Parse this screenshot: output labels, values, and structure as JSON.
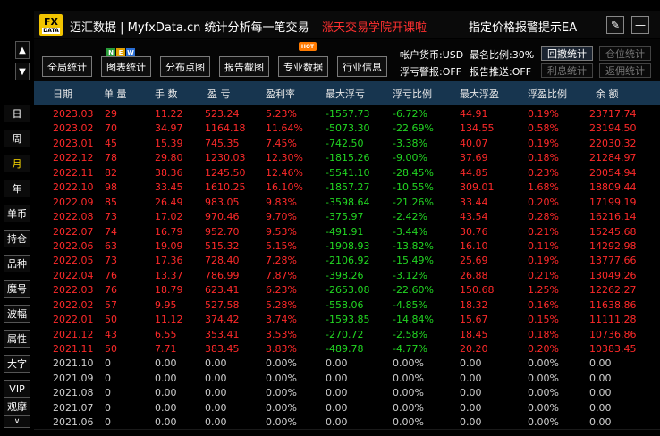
{
  "header": {
    "logo_fx": "FX",
    "logo_data": "DATA",
    "app_title": "迈汇数据 | MyfxData.cn  统计分析每一笔交易",
    "promo": "涨天交易学院开课啦",
    "ea_label": "指定价格报警提示EA",
    "edit_icon": "✎",
    "min_icon": "—"
  },
  "sidebar": {
    "up_arrow": "▲",
    "down_arrow": "▼",
    "period_items": [
      "日",
      "周",
      "月",
      "年"
    ],
    "active_period": "月",
    "tool_items": [
      "单币",
      "持仓",
      "品种",
      "魔号",
      "波幅",
      "属性",
      "大字",
      "VIP",
      "观摩"
    ],
    "more_arrow": "∨"
  },
  "toolbar": {
    "buttons": [
      "全局统计",
      "图表统计",
      "分布点图",
      "报告截图",
      "专业数据",
      "行业信息"
    ],
    "badge_new": [
      "N",
      "E",
      "W"
    ],
    "badge_hot": "HOT",
    "account_currency": "帐户货币:USD",
    "max_ratio": "最名比例:30%",
    "floating_alert": "浮亏警报:OFF",
    "report_push": "报告推送:OFF",
    "small_buttons": [
      "回撤统计",
      "仓位统计",
      "利息统计",
      "返佣统计"
    ]
  },
  "table": {
    "columns": [
      "日期",
      "单 量",
      "手 数",
      "盈 亏",
      "盈利率",
      "最大浮亏",
      "浮亏比例",
      "最大浮盈",
      "浮盈比例",
      "余 额"
    ],
    "rows": [
      [
        "2023.03",
        "29",
        "11.22",
        "523.24",
        "5.23%",
        "-1557.73",
        "-6.72%",
        "44.91",
        "0.19%",
        "23717.74"
      ],
      [
        "2023.02",
        "70",
        "34.97",
        "1164.18",
        "11.64%",
        "-5073.30",
        "-22.69%",
        "134.55",
        "0.58%",
        "23194.50"
      ],
      [
        "2023.01",
        "45",
        "15.39",
        "745.35",
        "7.45%",
        "-742.50",
        "-3.38%",
        "40.07",
        "0.19%",
        "22030.32"
      ],
      [
        "2022.12",
        "78",
        "29.80",
        "1230.03",
        "12.30%",
        "-1815.26",
        "-9.00%",
        "37.69",
        "0.18%",
        "21284.97"
      ],
      [
        "2022.11",
        "82",
        "38.36",
        "1245.50",
        "12.46%",
        "-5541.10",
        "-28.45%",
        "44.85",
        "0.23%",
        "20054.94"
      ],
      [
        "2022.10",
        "98",
        "33.45",
        "1610.25",
        "16.10%",
        "-1857.27",
        "-10.55%",
        "309.01",
        "1.68%",
        "18809.44"
      ],
      [
        "2022.09",
        "85",
        "26.49",
        "983.05",
        "9.83%",
        "-3598.64",
        "-21.26%",
        "33.44",
        "0.20%",
        "17199.19"
      ],
      [
        "2022.08",
        "73",
        "17.02",
        "970.46",
        "9.70%",
        "-375.97",
        "-2.42%",
        "43.54",
        "0.28%",
        "16216.14"
      ],
      [
        "2022.07",
        "74",
        "16.79",
        "952.70",
        "9.53%",
        "-491.91",
        "-3.44%",
        "30.76",
        "0.21%",
        "15245.68"
      ],
      [
        "2022.06",
        "63",
        "19.09",
        "515.32",
        "5.15%",
        "-1908.93",
        "-13.82%",
        "16.10",
        "0.11%",
        "14292.98"
      ],
      [
        "2022.05",
        "73",
        "17.36",
        "728.40",
        "7.28%",
        "-2106.92",
        "-15.49%",
        "25.69",
        "0.19%",
        "13777.66"
      ],
      [
        "2022.04",
        "76",
        "13.37",
        "786.99",
        "7.87%",
        "-398.26",
        "-3.12%",
        "26.88",
        "0.21%",
        "13049.26"
      ],
      [
        "2022.03",
        "76",
        "18.79",
        "623.41",
        "6.23%",
        "-2653.08",
        "-22.60%",
        "150.68",
        "1.25%",
        "12262.27"
      ],
      [
        "2022.02",
        "57",
        "9.95",
        "527.58",
        "5.28%",
        "-558.06",
        "-4.85%",
        "18.32",
        "0.16%",
        "11638.86"
      ],
      [
        "2022.01",
        "50",
        "11.12",
        "374.42",
        "3.74%",
        "-1593.85",
        "-14.84%",
        "15.67",
        "0.15%",
        "11111.28"
      ],
      [
        "2021.12",
        "43",
        "6.55",
        "353.41",
        "3.53%",
        "-270.72",
        "-2.58%",
        "18.45",
        "0.18%",
        "10736.86"
      ],
      [
        "2021.11",
        "50",
        "7.71",
        "383.45",
        "3.83%",
        "-489.78",
        "-4.77%",
        "20.20",
        "0.20%",
        "10383.45"
      ],
      [
        "2021.10",
        "0",
        "0.00",
        "0.00",
        "0.00%",
        "0.00",
        "0.00%",
        "0.00",
        "0.00%",
        "0.00"
      ],
      [
        "2021.09",
        "0",
        "0.00",
        "0.00",
        "0.00%",
        "0.00",
        "0.00%",
        "0.00",
        "0.00%",
        "0.00"
      ],
      [
        "2021.08",
        "0",
        "0.00",
        "0.00",
        "0.00%",
        "0.00",
        "0.00%",
        "0.00",
        "0.00%",
        "0.00"
      ],
      [
        "2021.07",
        "0",
        "0.00",
        "0.00",
        "0.00%",
        "0.00",
        "0.00%",
        "0.00",
        "0.00%",
        "0.00"
      ],
      [
        "2021.06",
        "0",
        "0.00",
        "0.00",
        "0.00%",
        "0.00",
        "0.00%",
        "0.00",
        "0.00%",
        "0.00"
      ]
    ],
    "active_row_count": 17
  },
  "colors": {
    "profit": "#ff2a2a",
    "loss": "#22d622",
    "neutral": "#cfcfcf",
    "header_bg": "#17354f",
    "promo": "#ff3030",
    "active_period": "#ffdd00"
  }
}
